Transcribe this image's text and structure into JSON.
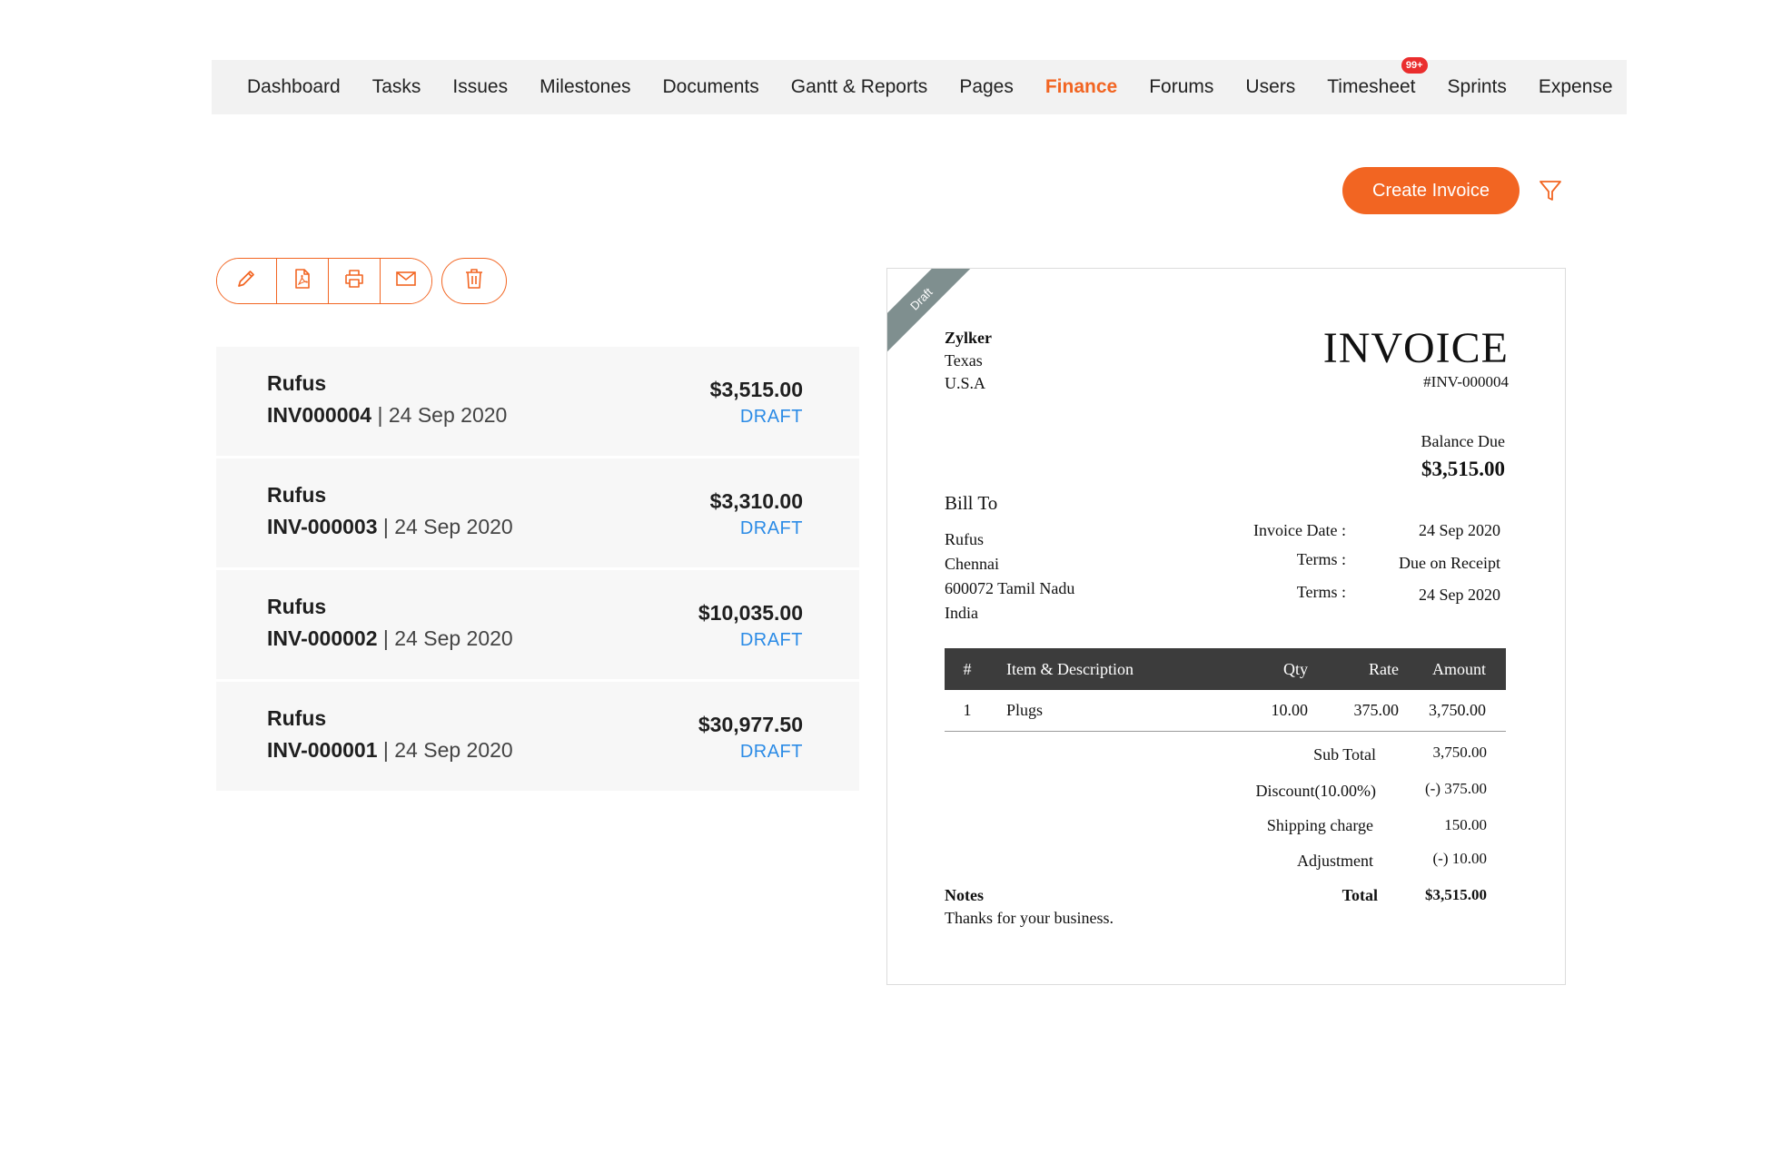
{
  "nav": {
    "items": [
      {
        "label": "Dashboard"
      },
      {
        "label": "Tasks"
      },
      {
        "label": "Issues"
      },
      {
        "label": "Milestones"
      },
      {
        "label": "Documents"
      },
      {
        "label": "Gantt & Reports"
      },
      {
        "label": "Pages"
      },
      {
        "label": "Finance",
        "active": true
      },
      {
        "label": "Forums"
      },
      {
        "label": "Users"
      },
      {
        "label": "Timesheet",
        "badge": "99+"
      },
      {
        "label": "Sprints"
      },
      {
        "label": "Expense"
      }
    ]
  },
  "toolbar": {
    "create_label": "Create Invoice",
    "icons": [
      "edit-icon",
      "pdf-icon",
      "print-icon",
      "email-icon",
      "delete-icon",
      "filter-icon"
    ]
  },
  "colors": {
    "accent": "#f26522",
    "status_draft": "#2b8be6",
    "badge": "#ea2d2d",
    "table_header": "#3c3c3c"
  },
  "invoices": [
    {
      "customer": "Rufus",
      "number": "INV000004",
      "date": "24 Sep 2020",
      "amount": "$3,515.00",
      "status": "DRAFT"
    },
    {
      "customer": "Rufus",
      "number": "INV-000003",
      "date": "24 Sep 2020",
      "amount": "$3,310.00",
      "status": "DRAFT"
    },
    {
      "customer": "Rufus",
      "number": "INV-000002",
      "date": "24 Sep 2020",
      "amount": "$10,035.00",
      "status": "DRAFT"
    },
    {
      "customer": "Rufus",
      "number": "INV-000001",
      "date": "24 Sep 2020",
      "amount": "$30,977.50",
      "status": "DRAFT"
    }
  ],
  "preview": {
    "ribbon": "Draft",
    "company": {
      "name": "Zylker",
      "line1": "Texas",
      "line2": "U.S.A"
    },
    "title": "INVOICE",
    "number": "#INV-000004",
    "balance_label": "Balance Due",
    "balance_value": "$3,515.00",
    "bill_to_label": "Bill To",
    "bill_to": [
      "Rufus",
      "Chennai",
      "600072 Tamil Nadu",
      "India"
    ],
    "meta": [
      {
        "label": "Invoice Date :",
        "value": "24 Sep 2020"
      },
      {
        "label": "Terms :",
        "value": "Due on Receipt"
      },
      {
        "label": "Terms :",
        "value": "24 Sep 2020"
      }
    ],
    "table": {
      "headers": [
        "#",
        "Item & Description",
        "Qty",
        "Rate",
        "Amount"
      ],
      "rows": [
        {
          "num": "1",
          "desc": "Plugs",
          "qty": "10.00",
          "rate": "375.00",
          "amount": "3,750.00"
        }
      ]
    },
    "totals": [
      {
        "label": "Sub Total",
        "value": "3,750.00"
      },
      {
        "label": "Discount(10.00%)",
        "value": "(-) 375.00"
      },
      {
        "label": "Shipping charge",
        "value": "150.00"
      },
      {
        "label": "Adjustment",
        "value": "(-) 10.00"
      },
      {
        "label": "Total",
        "value": "$3,515.00"
      }
    ],
    "notes_label": "Notes",
    "notes_text": "Thanks for your business."
  }
}
